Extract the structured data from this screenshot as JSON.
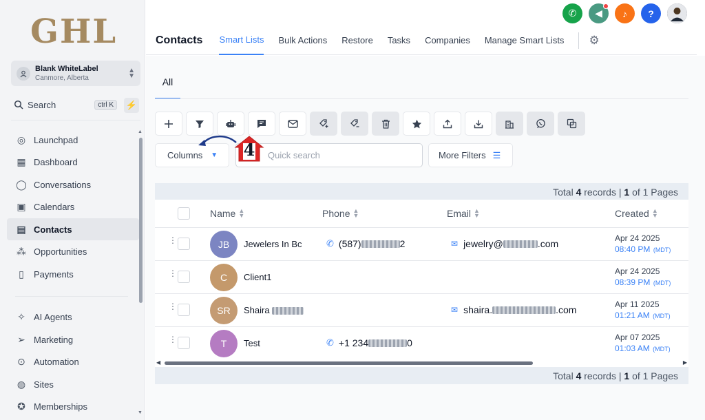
{
  "brand": {
    "logo_text": "GHL"
  },
  "location": {
    "name": "Blank WhiteLabel",
    "sub": "Canmore, Alberta"
  },
  "search": {
    "label": "Search",
    "shortcut": "ctrl K"
  },
  "sidebar": {
    "items": [
      {
        "label": "Launchpad",
        "icon": "rocket-icon"
      },
      {
        "label": "Dashboard",
        "icon": "grid-icon"
      },
      {
        "label": "Conversations",
        "icon": "chat-icon"
      },
      {
        "label": "Calendars",
        "icon": "calendar-icon"
      },
      {
        "label": "Contacts",
        "icon": "contacts-icon",
        "active": true
      },
      {
        "label": "Opportunities",
        "icon": "opportunities-icon"
      },
      {
        "label": "Payments",
        "icon": "payments-icon"
      },
      {
        "label": "AI Agents",
        "icon": "sparkle-icon"
      },
      {
        "label": "Marketing",
        "icon": "send-icon"
      },
      {
        "label": "Automation",
        "icon": "automation-icon"
      },
      {
        "label": "Sites",
        "icon": "globe-icon"
      },
      {
        "label": "Memberships",
        "icon": "award-icon"
      }
    ]
  },
  "topbar": {
    "icons": [
      {
        "name": "phone-icon",
        "color": "#16a34a"
      },
      {
        "name": "megaphone-icon",
        "color": "#4a9a82"
      },
      {
        "name": "bell-icon",
        "color": "#f97316"
      },
      {
        "name": "help-icon",
        "color": "#2563eb"
      }
    ]
  },
  "header": {
    "title": "Contacts",
    "tabs": [
      "Smart Lists",
      "Bulk Actions",
      "Restore",
      "Tasks",
      "Companies",
      "Manage Smart Lists"
    ],
    "active_tab": "Smart Lists"
  },
  "list_tab": "All",
  "toolbar": {
    "icons": [
      "add-icon",
      "filter-icon",
      "robot-icon",
      "message-icon",
      "email-icon",
      "add-tag-icon",
      "remove-tag-icon",
      "delete-icon",
      "star-icon",
      "export-icon",
      "import-icon",
      "company-icon",
      "whatsapp-icon",
      "merge-icon"
    ]
  },
  "filters": {
    "columns_label": "Columns",
    "quick_search_placeholder": "Quick search",
    "more_filters_label": "More Filters"
  },
  "annotation": {
    "step": "4"
  },
  "summary": {
    "prefix": "Total",
    "count": "4",
    "records": "records |",
    "page": "1",
    "of_pages": "of 1 Pages"
  },
  "table": {
    "headers": {
      "name": "Name",
      "phone": "Phone",
      "email": "Email",
      "created": "Created"
    },
    "rows": [
      {
        "initials": "JB",
        "avatar_color": "#7c85c2",
        "name": "Jewelers In Bc",
        "phone_visible_start": "(587) ",
        "phone_visible_end": "2",
        "email_visible_start": "jewelry@",
        "email_visible_end": ".com",
        "date": "Apr 24 2025",
        "time": "08:40 PM",
        "tz": "(MDT)"
      },
      {
        "initials": "C",
        "avatar_color": "#c4996b",
        "name": "Client1",
        "date": "Apr 24 2025",
        "time": "08:39 PM",
        "tz": "(MDT)"
      },
      {
        "initials": "SR",
        "avatar_color": "#c49b73",
        "name": "Shaira",
        "email_visible_start": "shaira.",
        "email_visible_end": ".com",
        "date": "Apr 11 2025",
        "time": "01:21 AM",
        "tz": "(MDT)"
      },
      {
        "initials": "T",
        "avatar_color": "#b57cc2",
        "name": "Test",
        "phone_visible_start": "+1 234 ",
        "phone_visible_end": "0",
        "date": "Apr 07 2025",
        "time": "01:03 AM",
        "tz": "(MDT)"
      }
    ]
  },
  "colors": {
    "accent": "#3b82f6",
    "marker": "#dc2626"
  }
}
